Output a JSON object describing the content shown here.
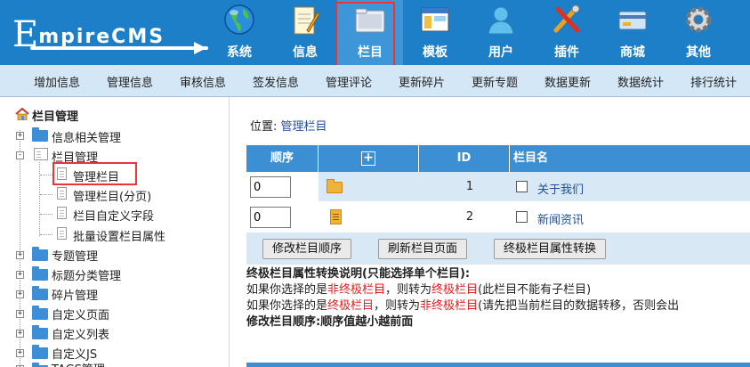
{
  "logo": {
    "first": "E",
    "rest": "mpireCMS"
  },
  "nav": [
    {
      "label": "系统",
      "icon": "globe-icon"
    },
    {
      "label": "信息",
      "icon": "notepad-icon"
    },
    {
      "label": "栏目",
      "icon": "folder-icon"
    },
    {
      "label": "模板",
      "icon": "window-icon"
    },
    {
      "label": "用户",
      "icon": "user-icon"
    },
    {
      "label": "插件",
      "icon": "tools-icon"
    },
    {
      "label": "商城",
      "icon": "card-icon"
    },
    {
      "label": "其他",
      "icon": "gear-icon"
    }
  ],
  "submenu": [
    "增加信息",
    "管理信息",
    "审核信息",
    "签发信息",
    "管理评论",
    "更新碎片",
    "更新专题",
    "数据更新",
    "数据统计",
    "排行统计"
  ],
  "tree": {
    "root": "栏目管理",
    "items": [
      {
        "label": "信息相关管理",
        "type": "folder"
      },
      {
        "label": "栏目管理",
        "type": "open"
      },
      {
        "label": "管理栏目",
        "type": "child"
      },
      {
        "label": "管理栏目(分页)",
        "type": "child"
      },
      {
        "label": "栏目自定义字段",
        "type": "child"
      },
      {
        "label": "批量设置栏目属性",
        "type": "child"
      },
      {
        "label": "专题管理",
        "type": "folder"
      },
      {
        "label": "标题分类管理",
        "type": "folder"
      },
      {
        "label": "碎片管理",
        "type": "folder"
      },
      {
        "label": "自定义页面",
        "type": "folder"
      },
      {
        "label": "自定义列表",
        "type": "folder"
      },
      {
        "label": "自定义JS",
        "type": "folder"
      },
      {
        "label": "TAGS管理",
        "type": "folder"
      }
    ]
  },
  "breadcrumb": {
    "prefix": "位置: ",
    "link": "管理栏目"
  },
  "table": {
    "headers": {
      "order": "顺序",
      "add": "+",
      "id": "ID",
      "name": "栏目名"
    },
    "rows": [
      {
        "order": "0",
        "id": "1",
        "name": "关于我们",
        "icon": "folder-icon"
      },
      {
        "order": "0",
        "id": "2",
        "name": "新闻资讯",
        "icon": "document-icon"
      }
    ],
    "buttons": [
      "修改栏目顺序",
      "刷新栏目页面",
      "终极栏目属性转换"
    ]
  },
  "notes": {
    "title": "终极栏目属性转换说明(只能选择单个栏目):",
    "line1": {
      "a": "如果你选择的是",
      "b": "非终极栏目",
      "c": "，则转为",
      "d": "终极栏目",
      "e": "(此栏目不能有子栏目)"
    },
    "line2": {
      "a": "如果你选择的是",
      "b": "终极栏目",
      "c": "，则转为",
      "d": "非终极栏目",
      "e": "(请先把当前栏目的数据转移，否则会出"
    },
    "line3": "修改栏目顺序:顺序值越小越前面"
  },
  "colors": {
    "header": "#1e7fc9",
    "submenu": "#d3e7f7",
    "table_head": "#3d8fd4",
    "highlight": "#e33333"
  }
}
